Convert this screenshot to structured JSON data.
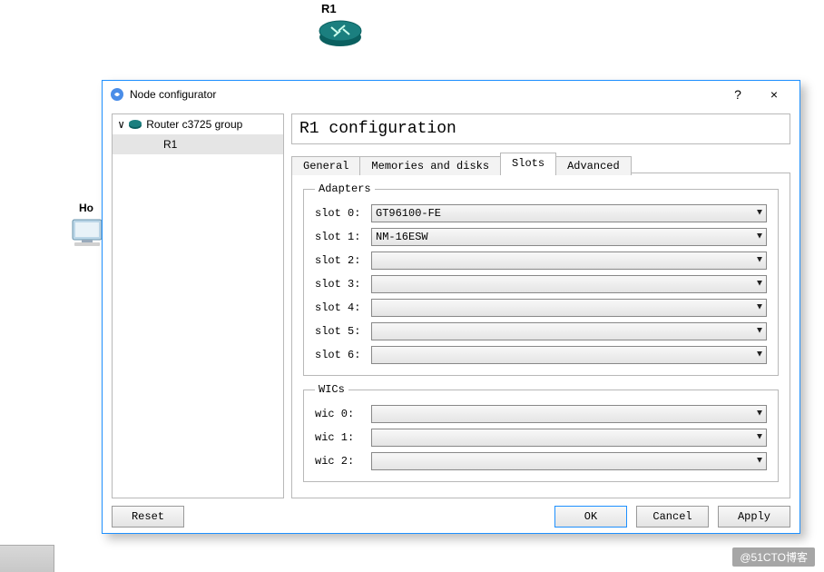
{
  "canvas": {
    "routerLabel": "R1",
    "hostLabel": "Ho"
  },
  "dialog": {
    "title": "Node configurator",
    "help": "?",
    "close": "×",
    "tree": {
      "groupLabel": "Router c3725 group",
      "itemLabel": "R1",
      "collapseGlyph": "∨"
    },
    "main": {
      "title": "R1 configuration",
      "tabs": {
        "general": "General",
        "memories": "Memories and disks",
        "slots": "Slots",
        "advanced": "Advanced"
      },
      "adapters": {
        "legend": "Adapters",
        "rows": [
          {
            "label": "slot 0:",
            "value": "GT96100-FE"
          },
          {
            "label": "slot 1:",
            "value": "NM-16ESW"
          },
          {
            "label": "slot 2:",
            "value": ""
          },
          {
            "label": "slot 3:",
            "value": ""
          },
          {
            "label": "slot 4:",
            "value": ""
          },
          {
            "label": "slot 5:",
            "value": ""
          },
          {
            "label": "slot 6:",
            "value": ""
          }
        ]
      },
      "wics": {
        "legend": "WICs",
        "rows": [
          {
            "label": "wic 0:",
            "value": ""
          },
          {
            "label": "wic 1:",
            "value": ""
          },
          {
            "label": "wic 2:",
            "value": ""
          }
        ]
      }
    },
    "buttons": {
      "reset": "Reset",
      "ok": "OK",
      "cancel": "Cancel",
      "apply": "Apply"
    }
  },
  "watermark": "@51CTO博客"
}
